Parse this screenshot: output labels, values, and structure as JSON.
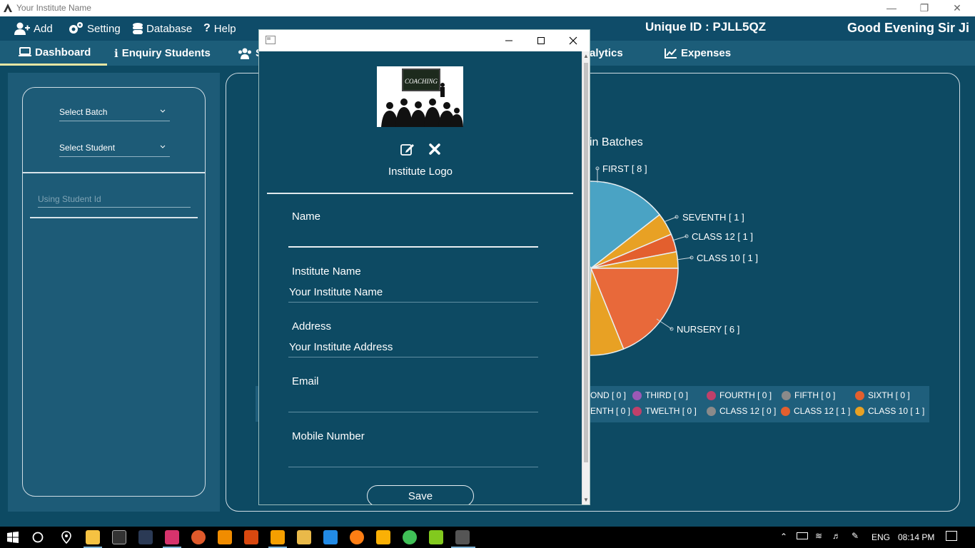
{
  "window": {
    "title": "Your Institute Name",
    "controls": [
      "minimize",
      "restore",
      "close"
    ]
  },
  "menu": {
    "items": [
      {
        "label": "Add",
        "icon": "add-user-icon"
      },
      {
        "label": "Setting",
        "icon": "gears-icon"
      },
      {
        "label": "Database",
        "icon": "database-icon"
      },
      {
        "label": "Help",
        "icon": "question-icon"
      }
    ],
    "unique_id": "Unique ID : PJLL5QZ",
    "greeting": "Good Evening Sir Ji"
  },
  "tabs": [
    {
      "label": "Dashboard",
      "icon": "laptop-icon",
      "active": true
    },
    {
      "label": "Enquiry Students",
      "icon": "info-icon"
    },
    {
      "label": "S",
      "icon": "users-icon"
    },
    {
      "label": "alytics",
      "icon": ""
    },
    {
      "label": "Expenses",
      "icon": "line-chart-icon"
    }
  ],
  "sidebar": {
    "select_batch": "Select Batch",
    "select_student": "Select Student",
    "student_id_placeholder": "Using Student Id"
  },
  "chart_data": {
    "type": "pie",
    "title": "in Batches",
    "visible_slices": [
      {
        "label": "FIRST [ 8 ]",
        "value": 8,
        "color": "#4aa3c4"
      },
      {
        "label": "SEVENTH [ 1 ]",
        "value": 1,
        "color": "#e8a124"
      },
      {
        "label": "CLASS 12 [ 1 ]",
        "value": 1,
        "color": "#e35f2e"
      },
      {
        "label": "CLASS 10 [ 1 ]",
        "value": 1,
        "color": "#e8a124"
      },
      {
        "label": "NURSERY [ 6 ]",
        "value": 6,
        "color": "#e8693a"
      }
    ],
    "legend": [
      {
        "label": "OND [ 0 ]",
        "color": ""
      },
      {
        "label": "THIRD [ 0 ]",
        "color": "#9b59b6"
      },
      {
        "label": "FOURTH [ 0 ]",
        "color": "#c0406a"
      },
      {
        "label": "FIFTH [ 0 ]",
        "color": "#8a8a8a"
      },
      {
        "label": "SIXTH [ 0 ]",
        "color": "#e35f2e"
      },
      {
        "label": "ENTH [ 0 ]",
        "color": ""
      },
      {
        "label": "TWELTH [ 0 ]",
        "color": "#c0406a"
      },
      {
        "label": "CLASS 12 [ 0 ]",
        "color": "#8a8a8a"
      },
      {
        "label": "CLASS 12 [ 1 ]",
        "color": "#e35f2e"
      },
      {
        "label": "CLASS 10 [ 1 ]",
        "color": "#e8a124"
      }
    ]
  },
  "dialog": {
    "logo_caption": "Institute Logo",
    "logo_text": "COACHING",
    "fields": {
      "name": {
        "label": "Name",
        "value": ""
      },
      "institute_name": {
        "label": "Institute Name",
        "value": "Your Institute Name"
      },
      "address": {
        "label": "Address",
        "value": "Your Institute Address"
      },
      "email": {
        "label": "Email",
        "value": ""
      },
      "mobile": {
        "label": "Mobile Number",
        "value": ""
      }
    },
    "save_label": "Save"
  },
  "taskbar": {
    "language": "ENG",
    "time": "08:14 PM"
  },
  "colors": {
    "background": "#0d4a63",
    "tabbar": "#1c5d79",
    "panel": "#1d5b77",
    "active_tab_underline": "#e7e7a3"
  }
}
